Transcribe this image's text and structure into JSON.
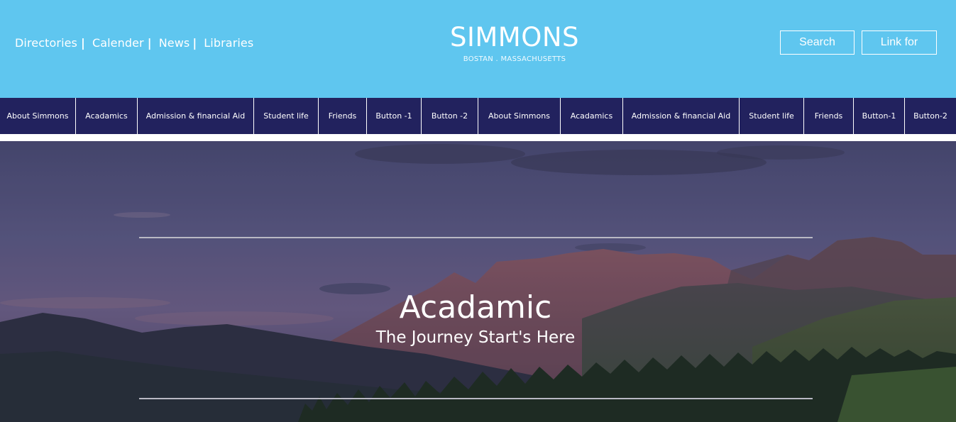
{
  "header": {
    "links": [
      "Directories",
      "Calender",
      "News",
      "Libraries"
    ],
    "separator": "|",
    "brand_title": "SIMMONS",
    "brand_subtitle": "BOSTAN . MASSACHUSETTS",
    "search_label": "Search",
    "link_for_label": "Link for"
  },
  "nav": {
    "items": [
      "About Simmons",
      "Acadamics",
      "Admission & financial Aid",
      "Student life",
      "Friends",
      "Button -1",
      "Button -2",
      "About Simmons",
      "Acadamics",
      "Admission & financial Aid",
      "Student life",
      "Friends",
      "Button-1",
      "Button-2"
    ]
  },
  "hero": {
    "title": "Acadamic",
    "subtitle": "The Journey Start's Here"
  },
  "colors": {
    "header_bg": "#5fc6ef",
    "nav_bg": "#22225e",
    "text_light": "#ffffff"
  }
}
